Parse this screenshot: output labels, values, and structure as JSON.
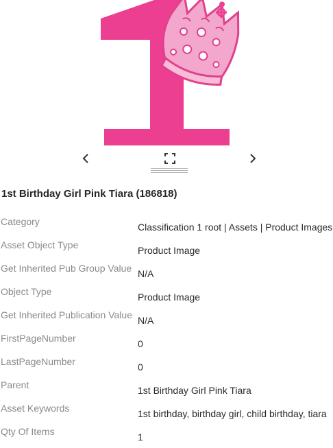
{
  "asset": {
    "title": "1st Birthday Girl Pink Tiara (186818)"
  },
  "viewer": {
    "prev_icon": "chevron-left-icon",
    "next_icon": "chevron-right-icon",
    "fullscreen_icon": "fullscreen-icon",
    "resize_icon": "resize-grip-icon",
    "accent_pink": "#ec3f91",
    "crown_pink": "#f4a7cc"
  },
  "properties": [
    {
      "label": "Category",
      "value": "Classification 1 root | Assets | Product Images"
    },
    {
      "label": "Asset Object Type",
      "value": "Product Image"
    },
    {
      "label": "Get Inherited Pub Group Value",
      "value": "N/A"
    },
    {
      "label": "Object Type",
      "value": "Product Image"
    },
    {
      "label": "Get Inherited Publication Value",
      "value": "N/A"
    },
    {
      "label": "FirstPageNumber",
      "value": "0"
    },
    {
      "label": "LastPageNumber",
      "value": "0"
    },
    {
      "label": "Parent",
      "value": "1st Birthday Girl Pink Tiara"
    },
    {
      "label": "Asset Keywords",
      "value": "1st birthday, birthday girl, child birthday, tiara"
    },
    {
      "label": "Qty Of Items",
      "value": "1"
    }
  ]
}
